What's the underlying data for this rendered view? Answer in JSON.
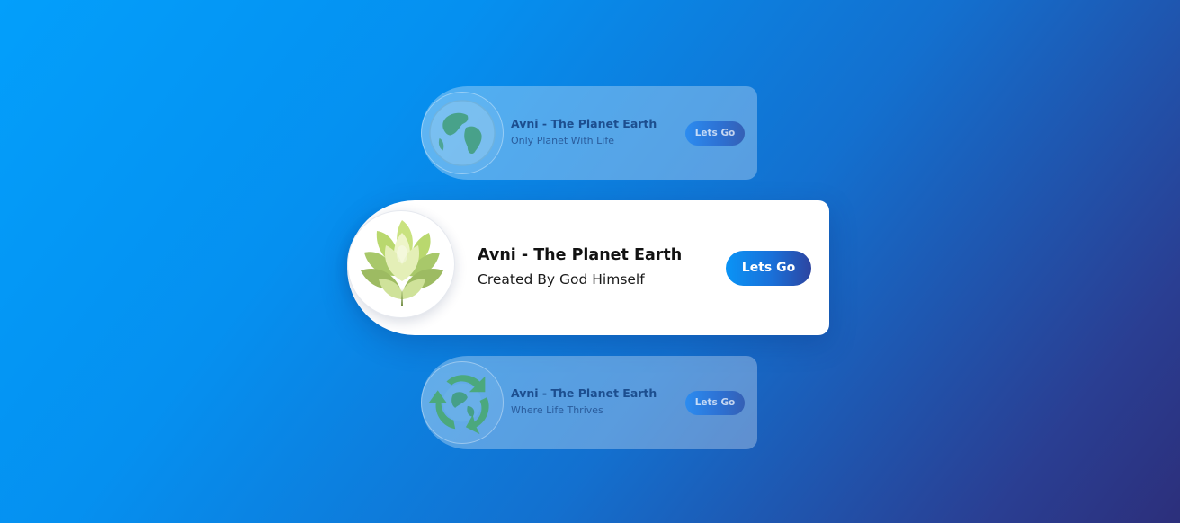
{
  "cards": [
    {
      "title": "Avni - The Planet Earth",
      "subtitle": "Only Planet With Life",
      "button_label": "Lets Go",
      "icon": "globe-icon"
    },
    {
      "title": "Avni - The Planet Earth",
      "subtitle": "Created By God Himself",
      "button_label": "Lets Go",
      "icon": "lotus-flower-icon"
    },
    {
      "title": "Avni - The Planet Earth",
      "subtitle": "Where Life Thrives",
      "button_label": "Lets Go",
      "icon": "recycle-globe-icon"
    }
  ],
  "colors": {
    "background_start": "#039ffb",
    "background_end": "#2c2f7b",
    "button_start": "#0a94f6",
    "button_end": "#2d45a0",
    "card_featured_bg": "#ffffff"
  }
}
